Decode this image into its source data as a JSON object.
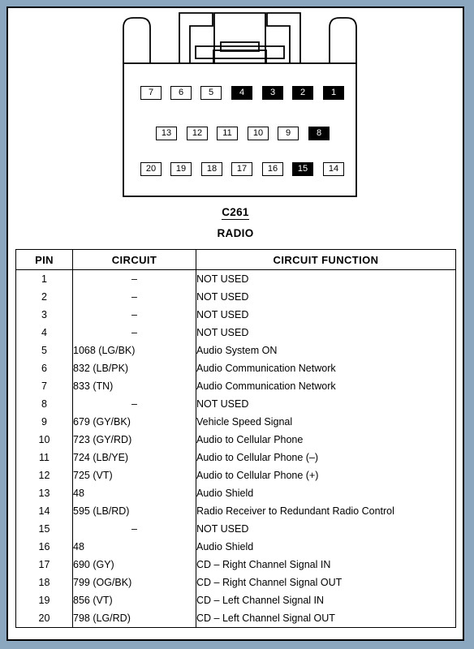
{
  "document": {
    "page_background": "#ffffff",
    "outer_background": "#8ba6bf",
    "border_color": "#000000"
  },
  "connector": {
    "id_label": "C261",
    "name_label": "RADIO",
    "cavity_fill_black": "#000000",
    "cavity_fill_white": "#ffffff",
    "rows": [
      {
        "row_index": 1,
        "pins": [
          {
            "label": "7",
            "filled": false
          },
          {
            "label": "6",
            "filled": false
          },
          {
            "label": "5",
            "filled": false
          },
          {
            "label": "4",
            "filled": true
          },
          {
            "label": "3",
            "filled": true
          },
          {
            "label": "2",
            "filled": true
          },
          {
            "label": "1",
            "filled": true
          }
        ]
      },
      {
        "row_index": 2,
        "pins": [
          {
            "label": "13",
            "filled": false
          },
          {
            "label": "12",
            "filled": false
          },
          {
            "label": "11",
            "filled": false
          },
          {
            "label": "10",
            "filled": false
          },
          {
            "label": "9",
            "filled": false
          },
          {
            "label": "8",
            "filled": true
          }
        ]
      },
      {
        "row_index": 3,
        "pins": [
          {
            "label": "20",
            "filled": false
          },
          {
            "label": "19",
            "filled": false
          },
          {
            "label": "18",
            "filled": false
          },
          {
            "label": "17",
            "filled": false
          },
          {
            "label": "16",
            "filled": false
          },
          {
            "label": "15",
            "filled": true
          },
          {
            "label": "14",
            "filled": false
          }
        ]
      }
    ]
  },
  "table": {
    "headers": {
      "pin": "PIN",
      "circuit": "CIRCUIT",
      "function": "CIRCUIT FUNCTION"
    },
    "rows": [
      {
        "pin": "1",
        "circuit": "–",
        "function": "NOT USED"
      },
      {
        "pin": "2",
        "circuit": "–",
        "function": "NOT USED"
      },
      {
        "pin": "3",
        "circuit": "–",
        "function": "NOT USED"
      },
      {
        "pin": "4",
        "circuit": "–",
        "function": "NOT USED"
      },
      {
        "pin": "5",
        "circuit": "1068 (LG/BK)",
        "function": "Audio System ON"
      },
      {
        "pin": "6",
        "circuit": "832 (LB/PK)",
        "function": "Audio Communication Network"
      },
      {
        "pin": "7",
        "circuit": "833 (TN)",
        "function": "Audio Communication Network"
      },
      {
        "pin": "8",
        "circuit": "–",
        "function": "NOT USED"
      },
      {
        "pin": "9",
        "circuit": "679 (GY/BK)",
        "function": "Vehicle Speed Signal"
      },
      {
        "pin": "10",
        "circuit": "723 (GY/RD)",
        "function": "Audio to Cellular Phone"
      },
      {
        "pin": "11",
        "circuit": "724 (LB/YE)",
        "function": "Audio to Cellular Phone (–)"
      },
      {
        "pin": "12",
        "circuit": "725 (VT)",
        "function": "Audio to Cellular Phone (+)"
      },
      {
        "pin": "13",
        "circuit": "48",
        "function": "Audio Shield"
      },
      {
        "pin": "14",
        "circuit": "595 (LB/RD)",
        "function": "Radio Receiver to Redundant Radio Control"
      },
      {
        "pin": "15",
        "circuit": "–",
        "function": "NOT USED"
      },
      {
        "pin": "16",
        "circuit": "48",
        "function": "Audio Shield"
      },
      {
        "pin": "17",
        "circuit": "690 (GY)",
        "function": "CD – Right Channel Signal IN"
      },
      {
        "pin": "18",
        "circuit": "799 (OG/BK)",
        "function": "CD – Right Channel Signal OUT"
      },
      {
        "pin": "19",
        "circuit": "856 (VT)",
        "function": "CD – Left Channel Signal IN"
      },
      {
        "pin": "20",
        "circuit": "798 (LG/RD)",
        "function": "CD – Left Channel Signal OUT"
      }
    ]
  }
}
